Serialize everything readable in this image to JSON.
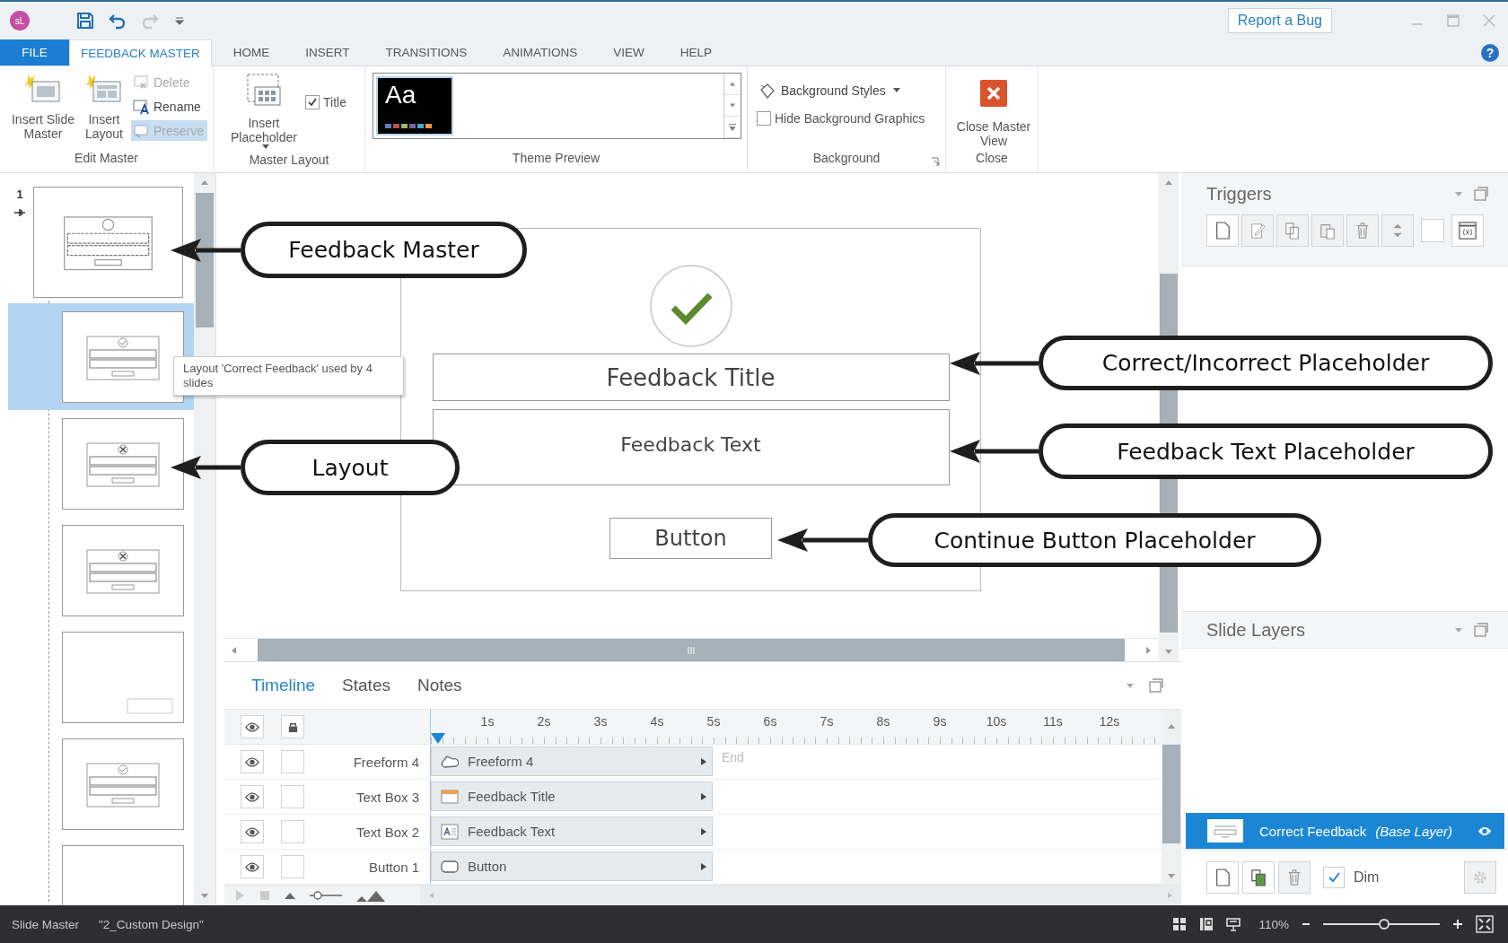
{
  "title_bar": {
    "logo": "sL",
    "report_bug": "Report a Bug"
  },
  "help": "?",
  "ribbon_tabs": [
    {
      "label": "FILE",
      "kind": "file",
      "selected": false
    },
    {
      "label": "FEEDBACK MASTER",
      "kind": "tab",
      "selected": true
    },
    {
      "label": "HOME",
      "kind": "tab",
      "selected": false
    },
    {
      "label": "INSERT",
      "kind": "tab",
      "selected": false
    },
    {
      "label": "TRANSITIONS",
      "kind": "tab",
      "selected": false
    },
    {
      "label": "ANIMATIONS",
      "kind": "tab",
      "selected": false
    },
    {
      "label": "VIEW",
      "kind": "tab",
      "selected": false
    },
    {
      "label": "HELP",
      "kind": "tab",
      "selected": false
    }
  ],
  "edit_master": {
    "label": "Edit Master",
    "buttons": [
      {
        "label": "Insert Slide Master",
        "kind": "master"
      },
      {
        "label": "Insert Layout",
        "kind": "layout"
      }
    ],
    "tools": [
      {
        "label": "Delete",
        "kind": "delete",
        "disabled": true,
        "pressed": false
      },
      {
        "label": "Rename",
        "kind": "rename",
        "disabled": false,
        "pressed": false
      },
      {
        "label": "Preserve",
        "kind": "preserve",
        "disabled": true,
        "pressed": true
      }
    ]
  },
  "master_layout": {
    "label": "Master Layout",
    "button": "Insert Placeholder",
    "title_option": {
      "label": "Title",
      "checked": true
    }
  },
  "theme_preview": {
    "label": "Theme Preview",
    "sample": "Aa"
  },
  "background": {
    "label": "Background",
    "styles": "Background Styles",
    "hide_graphics": {
      "label": "Hide Background Graphics",
      "checked": false
    }
  },
  "close": {
    "label": "Close",
    "button": "Close Master View"
  },
  "slide_panel": {
    "number": "1",
    "tooltip": "Layout 'Correct Feedback' used by 4 slides",
    "thumbnails": [
      {
        "kind": "master",
        "selected": false
      },
      {
        "kind": "correct",
        "selected": true
      },
      {
        "kind": "incorrect",
        "selected": false
      },
      {
        "kind": "incorrect",
        "selected": false
      },
      {
        "kind": "plain",
        "selected": false
      },
      {
        "kind": "correct",
        "selected": false
      },
      {
        "kind": "blank",
        "selected": false
      }
    ]
  },
  "slide": {
    "title": "Feedback Title",
    "text": "Feedback Text",
    "button": "Button"
  },
  "callouts": [
    {
      "label": "Feedback Master"
    },
    {
      "label": "Layout"
    },
    {
      "label": "Correct/Incorrect Placeholder"
    },
    {
      "label": "Feedback Text Placeholder"
    },
    {
      "label": "Continue Button Placeholder"
    }
  ],
  "timeline": {
    "tabs": [
      {
        "label": "Timeline",
        "selected": true
      },
      {
        "label": "States",
        "selected": false
      },
      {
        "label": "Notes",
        "selected": false
      }
    ],
    "ticks": [
      "1s",
      "2s",
      "3s",
      "4s",
      "5s",
      "6s",
      "7s",
      "8s",
      "9s",
      "10s",
      "11s",
      "12s"
    ],
    "end_label": "End",
    "rows": [
      {
        "name": "Freeform 4",
        "bar": "Freeform 4",
        "kind": "freeform",
        "visible": true,
        "locked": false
      },
      {
        "name": "Text Box 3",
        "bar": "Feedback Title",
        "kind": "title",
        "visible": true,
        "locked": false
      },
      {
        "name": "Text Box 2",
        "bar": "Feedback Text",
        "kind": "text",
        "visible": true,
        "locked": false
      },
      {
        "name": "Button 1",
        "bar": "Button",
        "kind": "button",
        "visible": true,
        "locked": false
      }
    ]
  },
  "triggers": {
    "title": "Triggers"
  },
  "slide_layers": {
    "title": "Slide Layers",
    "layers": [
      {
        "name": "Correct Feedback",
        "note": "(Base Layer)",
        "selected": true,
        "visible": true
      }
    ],
    "dim": {
      "label": "Dim",
      "checked": true
    }
  },
  "status_bar": {
    "view": "Slide Master",
    "design": "\"2_Custom Design\"",
    "zoom": {
      "reading": "110%",
      "level": 0.52
    }
  }
}
